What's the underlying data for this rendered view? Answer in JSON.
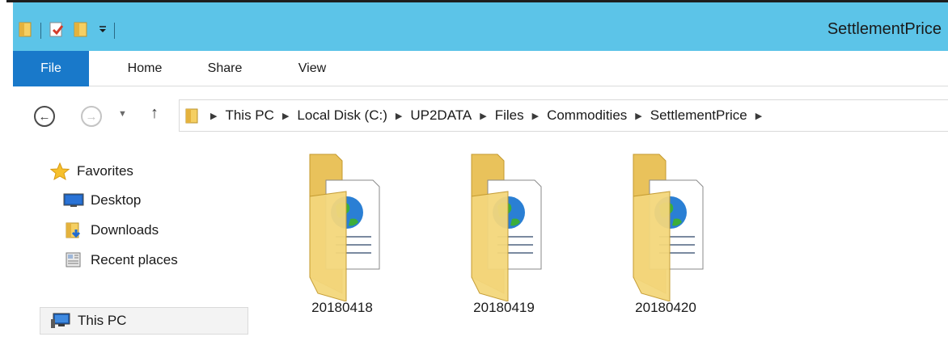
{
  "window": {
    "title": "SettlementPrice",
    "quick_access": [
      "folder-icon",
      "properties-icon",
      "new-folder-icon",
      "customize-dropdown-icon"
    ]
  },
  "ribbon": {
    "tabs": [
      {
        "label": "File",
        "active": true
      },
      {
        "label": "Home"
      },
      {
        "label": "Share"
      },
      {
        "label": "View"
      }
    ]
  },
  "address": {
    "back_icon": "back-arrow-icon",
    "forward_icon": "forward-arrow-icon",
    "up_icon": "up-arrow-icon",
    "breadcrumbs": [
      "This PC",
      "Local Disk (C:)",
      "UP2DATA",
      "Files",
      "Commodities",
      "SettlementPrice"
    ]
  },
  "navigation": {
    "favorites": "Favorites",
    "items": [
      {
        "label": "Desktop",
        "icon": "desktop-icon"
      },
      {
        "label": "Downloads",
        "icon": "downloads-icon"
      },
      {
        "label": "Recent places",
        "icon": "recent-places-icon"
      }
    ],
    "this_pc": "This PC"
  },
  "content": {
    "folders": [
      {
        "name": "20180418"
      },
      {
        "name": "20180419"
      },
      {
        "name": "20180420"
      }
    ]
  },
  "colors": {
    "titlebar": "#5cc4e8",
    "file_tab": "#1979ca",
    "folder": "#f4d77c"
  }
}
